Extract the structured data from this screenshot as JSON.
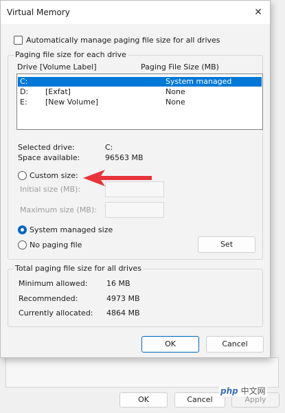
{
  "dialog": {
    "title": "Virtual Memory",
    "close_glyph": "✕",
    "auto_manage_label": "Automatically manage paging file size for all drives",
    "auto_manage_checked": false
  },
  "paging_group": {
    "label": "Paging file size for each drive",
    "columns": {
      "drive": "Drive  [Volume Label]",
      "size": "Paging File Size (MB)"
    },
    "rows": [
      {
        "drive": "C:",
        "label": "",
        "size": "System managed",
        "selected": true
      },
      {
        "drive": "D:",
        "label": "[Exfat]",
        "size": "None",
        "selected": false
      },
      {
        "drive": "E:",
        "label": "[New Volume]",
        "size": "None",
        "selected": false
      }
    ],
    "selected_drive_label": "Selected drive:",
    "selected_drive_value": "C:",
    "space_available_label": "Space available:",
    "space_available_value": "96563 MB",
    "custom_size_label": "Custom size:",
    "initial_size_label": "Initial size (MB):",
    "maximum_size_label": "Maximum size (MB):",
    "system_managed_label": "System managed size",
    "no_paging_label": "No paging file",
    "selected_option": "system_managed",
    "set_button": "Set"
  },
  "total_group": {
    "label": "Total paging file size for all drives",
    "minimum_label": "Minimum allowed:",
    "minimum_value": "16 MB",
    "recommended_label": "Recommended:",
    "recommended_value": "4973 MB",
    "allocated_label": "Currently allocated:",
    "allocated_value": "4864 MB"
  },
  "footer": {
    "ok": "OK",
    "cancel": "Cancel"
  },
  "background_window": {
    "ok": "OK",
    "cancel": "Cancel",
    "apply": "Apply"
  },
  "watermark": {
    "logo": "php",
    "text": "中文网"
  },
  "colors": {
    "accent": "#0067c0",
    "selection": "#0078d7",
    "arrow": "#e8333a"
  }
}
